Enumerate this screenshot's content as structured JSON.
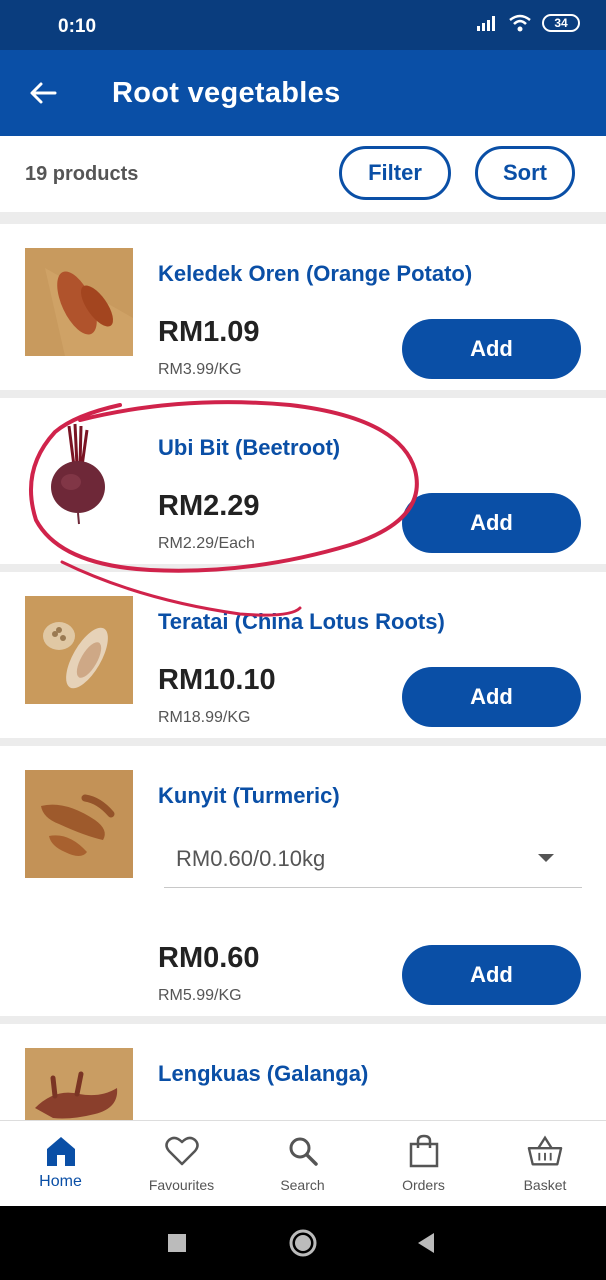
{
  "status_bar": {
    "time": "0:10",
    "battery": "34"
  },
  "header": {
    "title": "Root vegetables"
  },
  "toolbar": {
    "product_count": "19 products",
    "filter_label": "Filter",
    "sort_label": "Sort"
  },
  "products": [
    {
      "name": "Keledek Oren (Orange Potato)",
      "price": "RM1.09",
      "unit_price": "RM3.99/KG",
      "add_label": "Add"
    },
    {
      "name": "Ubi Bit (Beetroot)",
      "price": "RM2.29",
      "unit_price": "RM2.29/Each",
      "add_label": "Add"
    },
    {
      "name": "Teratai (China Lotus Roots)",
      "price": "RM10.10",
      "unit_price": "RM18.99/KG",
      "add_label": "Add"
    },
    {
      "name": "Kunyit (Turmeric)",
      "weight_option": "RM0.60/0.10kg",
      "price": "RM0.60",
      "unit_price": "RM5.99/KG",
      "add_label": "Add"
    },
    {
      "name": "Lengkuas (Galanga)"
    }
  ],
  "bottom_nav": {
    "home": "Home",
    "favourites": "Favourites",
    "search": "Search",
    "orders": "Orders",
    "basket": "Basket"
  },
  "colors": {
    "primary": "#0a4fa6",
    "status_bar": "#0a3d7e",
    "annotation": "#d0234b"
  }
}
